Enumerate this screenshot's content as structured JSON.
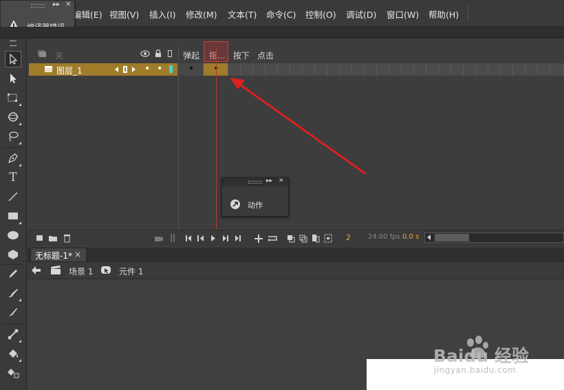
{
  "menu": {
    "items": [
      "编辑(E)",
      "视图(V)",
      "插入(I)",
      "修改(M)",
      "文本(T)",
      "命令(C)",
      "控制(O)",
      "调试(D)",
      "窗口(W)",
      "帮助(H)"
    ]
  },
  "error_panel": {
    "label": "编译器错误",
    "collapse": "▸▸",
    "close": "✕"
  },
  "timeline": {
    "layer_header_label": "关",
    "frame_labels": [
      "弹起",
      "指...",
      "按下",
      "点击"
    ],
    "layer": {
      "name": "图层_1",
      "bullets": [
        "•",
        "•"
      ]
    },
    "frames": {
      "keyframe_dots": [
        "•",
        "•"
      ]
    },
    "status": {
      "frame": "2",
      "fps": "24.00 fps",
      "time": "0.0 s"
    }
  },
  "document": {
    "tab_label": "无标题-1*",
    "tab_close": "×",
    "breadcrumb": {
      "scene": "场景 1",
      "symbol": "元件 1"
    }
  },
  "actions_panel": {
    "label": "动作",
    "collapse": "▸▸",
    "close": "✕"
  },
  "watermark": {
    "brand": "Baidu 经验",
    "url": "jingyan.baidu.com"
  },
  "colors": {
    "layer_selected": "#9f7c2a",
    "playhead": "#c0392b",
    "arrow": "#dd2020",
    "status_frame": "#e8a63a"
  }
}
